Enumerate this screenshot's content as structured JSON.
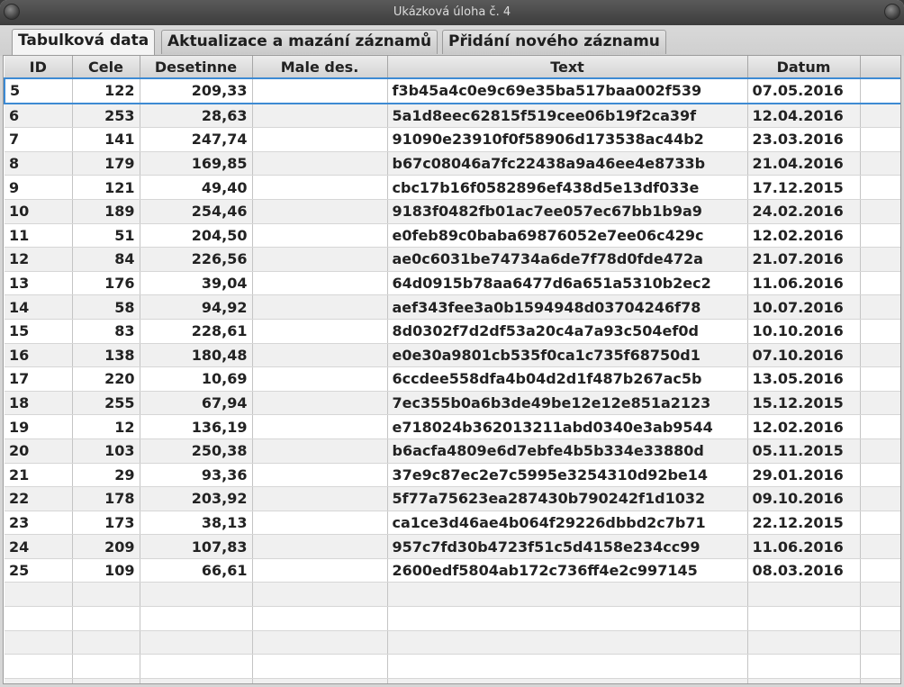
{
  "window": {
    "title": "Ukázková úloha č. 4"
  },
  "tabs": [
    {
      "label": "Tabulková data",
      "active": true
    },
    {
      "label": "Aktualizace a mazání záznamů",
      "active": false
    },
    {
      "label": "Přidání nového záznamu",
      "active": false
    }
  ],
  "table": {
    "columns": [
      "ID",
      "Cele",
      "Desetinne",
      "Male des.",
      "Text",
      "Datum",
      ""
    ],
    "selected_row_index": 0,
    "rows": [
      {
        "id": "5",
        "cele": "122",
        "desetinne": "209,33",
        "male_des": "",
        "text": "f3b45a4c0e9c69e35ba517baa002f539",
        "datum": "07.05.2016"
      },
      {
        "id": "6",
        "cele": "253",
        "desetinne": "28,63",
        "male_des": "",
        "text": "5a1d8eec62815f519cee06b19f2ca39f",
        "datum": "12.04.2016"
      },
      {
        "id": "7",
        "cele": "141",
        "desetinne": "247,74",
        "male_des": "",
        "text": "91090e23910f0f58906d173538ac44b2",
        "datum": "23.03.2016"
      },
      {
        "id": "8",
        "cele": "179",
        "desetinne": "169,85",
        "male_des": "",
        "text": "b67c08046a7fc22438a9a46ee4e8733b",
        "datum": "21.04.2016"
      },
      {
        "id": "9",
        "cele": "121",
        "desetinne": "49,40",
        "male_des": "",
        "text": "cbc17b16f0582896ef438d5e13df033e",
        "datum": "17.12.2015"
      },
      {
        "id": "10",
        "cele": "189",
        "desetinne": "254,46",
        "male_des": "",
        "text": "9183f0482fb01ac7ee057ec67bb1b9a9",
        "datum": "24.02.2016"
      },
      {
        "id": "11",
        "cele": "51",
        "desetinne": "204,50",
        "male_des": "",
        "text": "e0feb89c0baba69876052e7ee06c429c",
        "datum": "12.02.2016"
      },
      {
        "id": "12",
        "cele": "84",
        "desetinne": "226,56",
        "male_des": "",
        "text": "ae0c6031be74734a6de7f78d0fde472a",
        "datum": "21.07.2016"
      },
      {
        "id": "13",
        "cele": "176",
        "desetinne": "39,04",
        "male_des": "",
        "text": "64d0915b78aa6477d6a651a5310b2ec2",
        "datum": "11.06.2016"
      },
      {
        "id": "14",
        "cele": "58",
        "desetinne": "94,92",
        "male_des": "",
        "text": "aef343fee3a0b1594948d03704246f78",
        "datum": "10.07.2016"
      },
      {
        "id": "15",
        "cele": "83",
        "desetinne": "228,61",
        "male_des": "",
        "text": "8d0302f7d2df53a20c4a7a93c504ef0d",
        "datum": "10.10.2016"
      },
      {
        "id": "16",
        "cele": "138",
        "desetinne": "180,48",
        "male_des": "",
        "text": "e0e30a9801cb535f0ca1c735f68750d1",
        "datum": "07.10.2016"
      },
      {
        "id": "17",
        "cele": "220",
        "desetinne": "10,69",
        "male_des": "",
        "text": "6ccdee558dfa4b04d2d1f487b267ac5b",
        "datum": "13.05.2016"
      },
      {
        "id": "18",
        "cele": "255",
        "desetinne": "67,94",
        "male_des": "",
        "text": "7ec355b0a6b3de49be12e12e851a2123",
        "datum": "15.12.2015"
      },
      {
        "id": "19",
        "cele": "12",
        "desetinne": "136,19",
        "male_des": "",
        "text": "e718024b362013211abd0340e3ab9544",
        "datum": "12.02.2016"
      },
      {
        "id": "20",
        "cele": "103",
        "desetinne": "250,38",
        "male_des": "",
        "text": "b6acfa4809e6d7ebfe4b5b334e33880d",
        "datum": "05.11.2015"
      },
      {
        "id": "21",
        "cele": "29",
        "desetinne": "93,36",
        "male_des": "",
        "text": "37e9c87ec2e7c5995e3254310d92be14",
        "datum": "29.01.2016"
      },
      {
        "id": "22",
        "cele": "178",
        "desetinne": "203,92",
        "male_des": "",
        "text": "5f77a75623ea287430b790242f1d1032",
        "datum": "09.10.2016"
      },
      {
        "id": "23",
        "cele": "173",
        "desetinne": "38,13",
        "male_des": "",
        "text": "ca1ce3d46ae4b064f29226dbbd2c7b71",
        "datum": "22.12.2015"
      },
      {
        "id": "24",
        "cele": "209",
        "desetinne": "107,83",
        "male_des": "",
        "text": "957c7fd30b4723f51c5d4158e234cc99",
        "datum": "11.06.2016"
      },
      {
        "id": "25",
        "cele": "109",
        "desetinne": "66,61",
        "male_des": "",
        "text": "2600edf5804ab172c736ff4e2c997145",
        "datum": "08.03.2016"
      }
    ]
  }
}
